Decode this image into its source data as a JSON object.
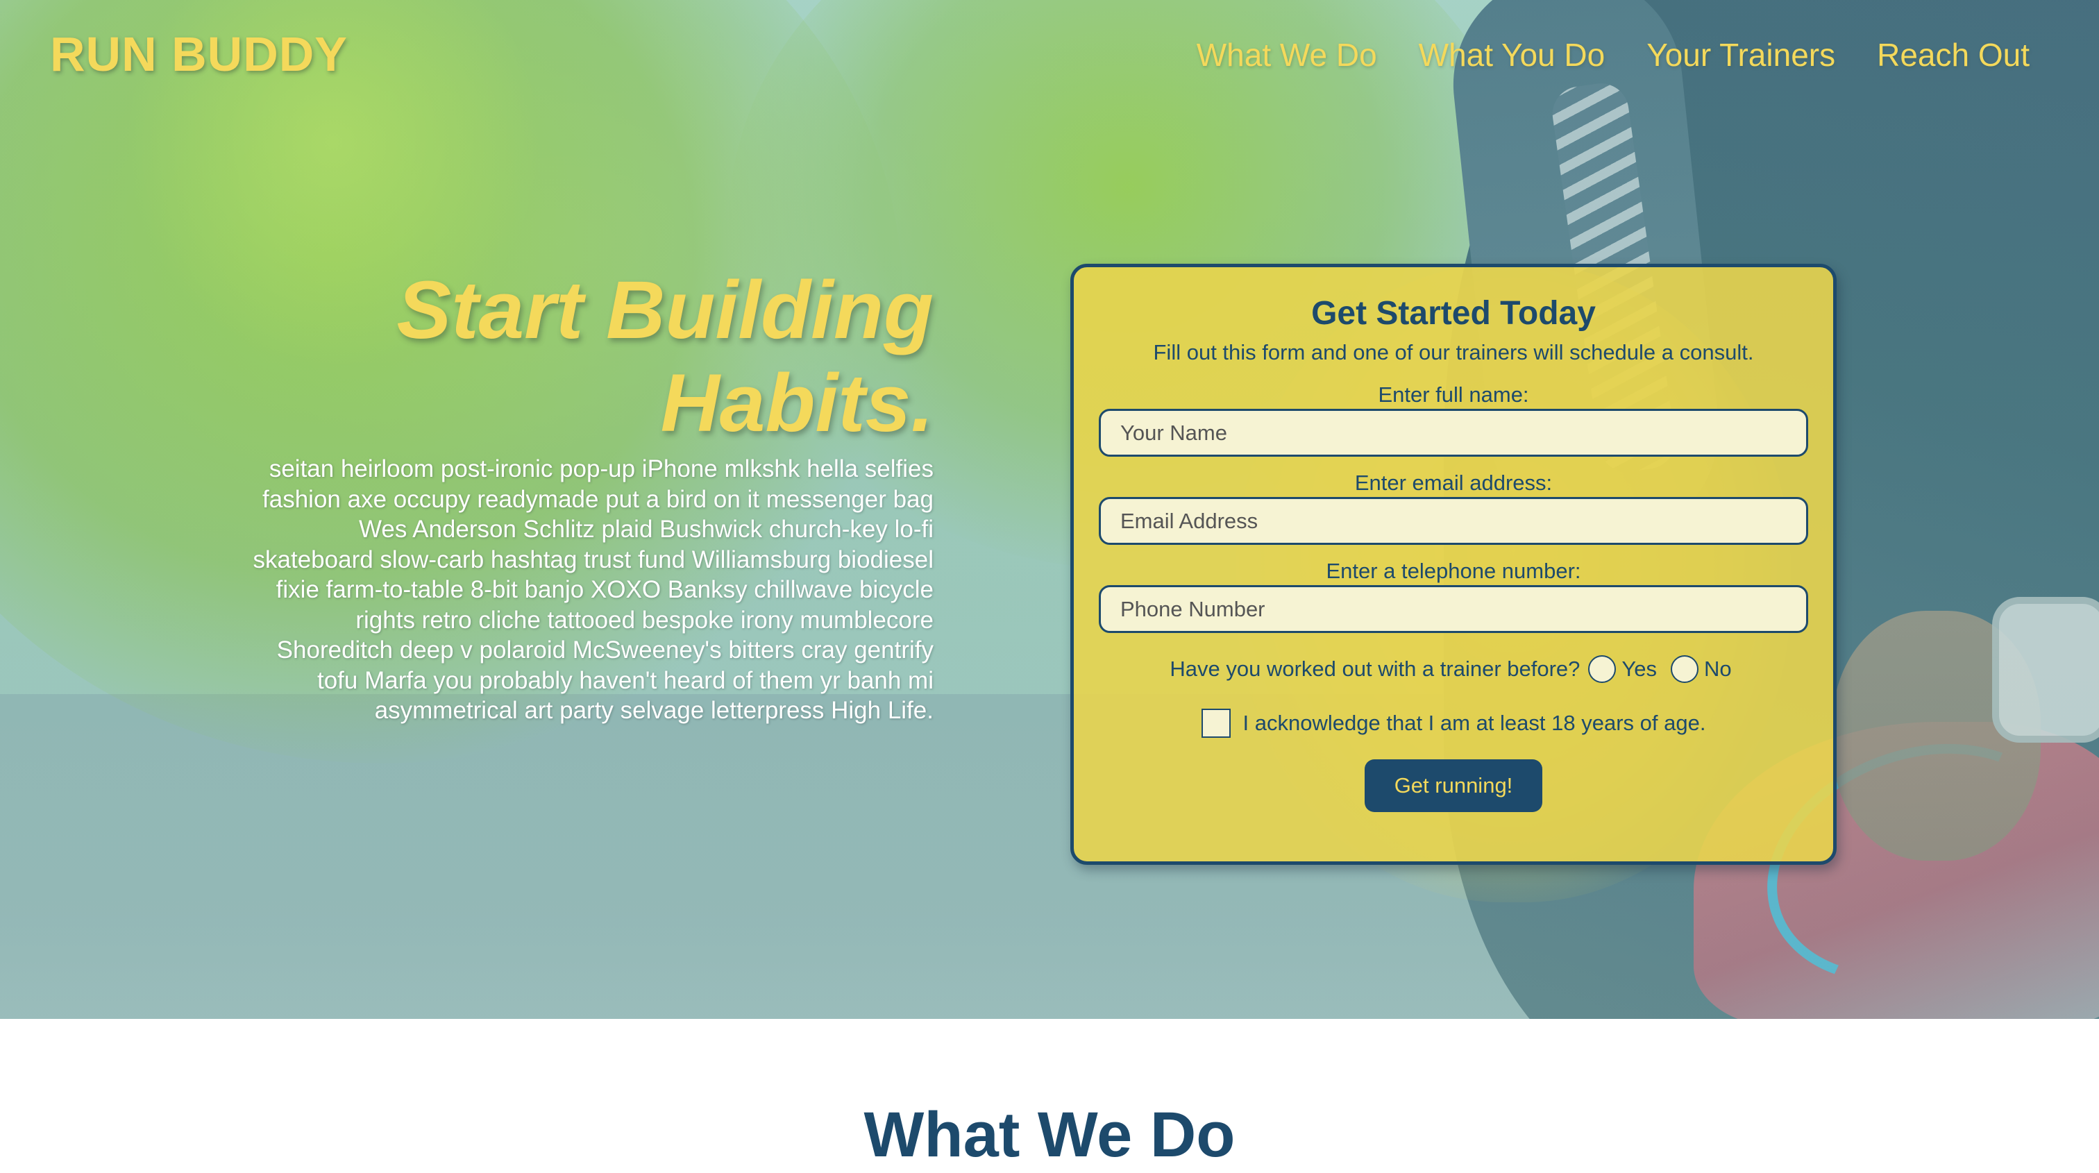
{
  "header": {
    "brand": "RUN BUDDY",
    "nav": [
      "What We Do",
      "What You Do",
      "Your Trainers",
      "Reach Out"
    ]
  },
  "hero": {
    "title_line1": "Start Building",
    "title_line2": "Habits.",
    "body": "seitan heirloom post-ironic pop-up iPhone mlkshk hella selfies fashion axe occupy readymade put a bird on it messenger bag Wes Anderson Schlitz plaid Bushwick church-key lo-fi skateboard slow-carb hashtag trust fund Williamsburg biodiesel fixie farm-to-table 8-bit banjo XOXO Banksy chillwave bicycle rights retro cliche tattooed bespoke irony mumblecore Shoreditch deep v polaroid McSweeney's bitters cray gentrify tofu Marfa you probably haven't heard of them yr banh mi asymmetrical art party selvage letterpress High Life."
  },
  "form": {
    "title": "Get Started Today",
    "subtitle": "Fill out this form and one of our trainers will schedule a consult.",
    "name_label": "Enter full name:",
    "name_placeholder": "Your Name",
    "email_label": "Enter email address:",
    "email_placeholder": "Email Address",
    "phone_label": "Enter a telephone number:",
    "phone_placeholder": "Phone Number",
    "trainer_question": "Have you worked out with a trainer before?",
    "yes_label": "Yes",
    "no_label": "No",
    "age_ack": "I acknowledge that I am at least 18 years of age.",
    "submit_label": "Get running!"
  },
  "next_section": {
    "title": "What We Do"
  },
  "colors": {
    "accent_yellow": "#f4d95b",
    "navy": "#1d4a6c",
    "form_bg": "#e8d44e"
  }
}
